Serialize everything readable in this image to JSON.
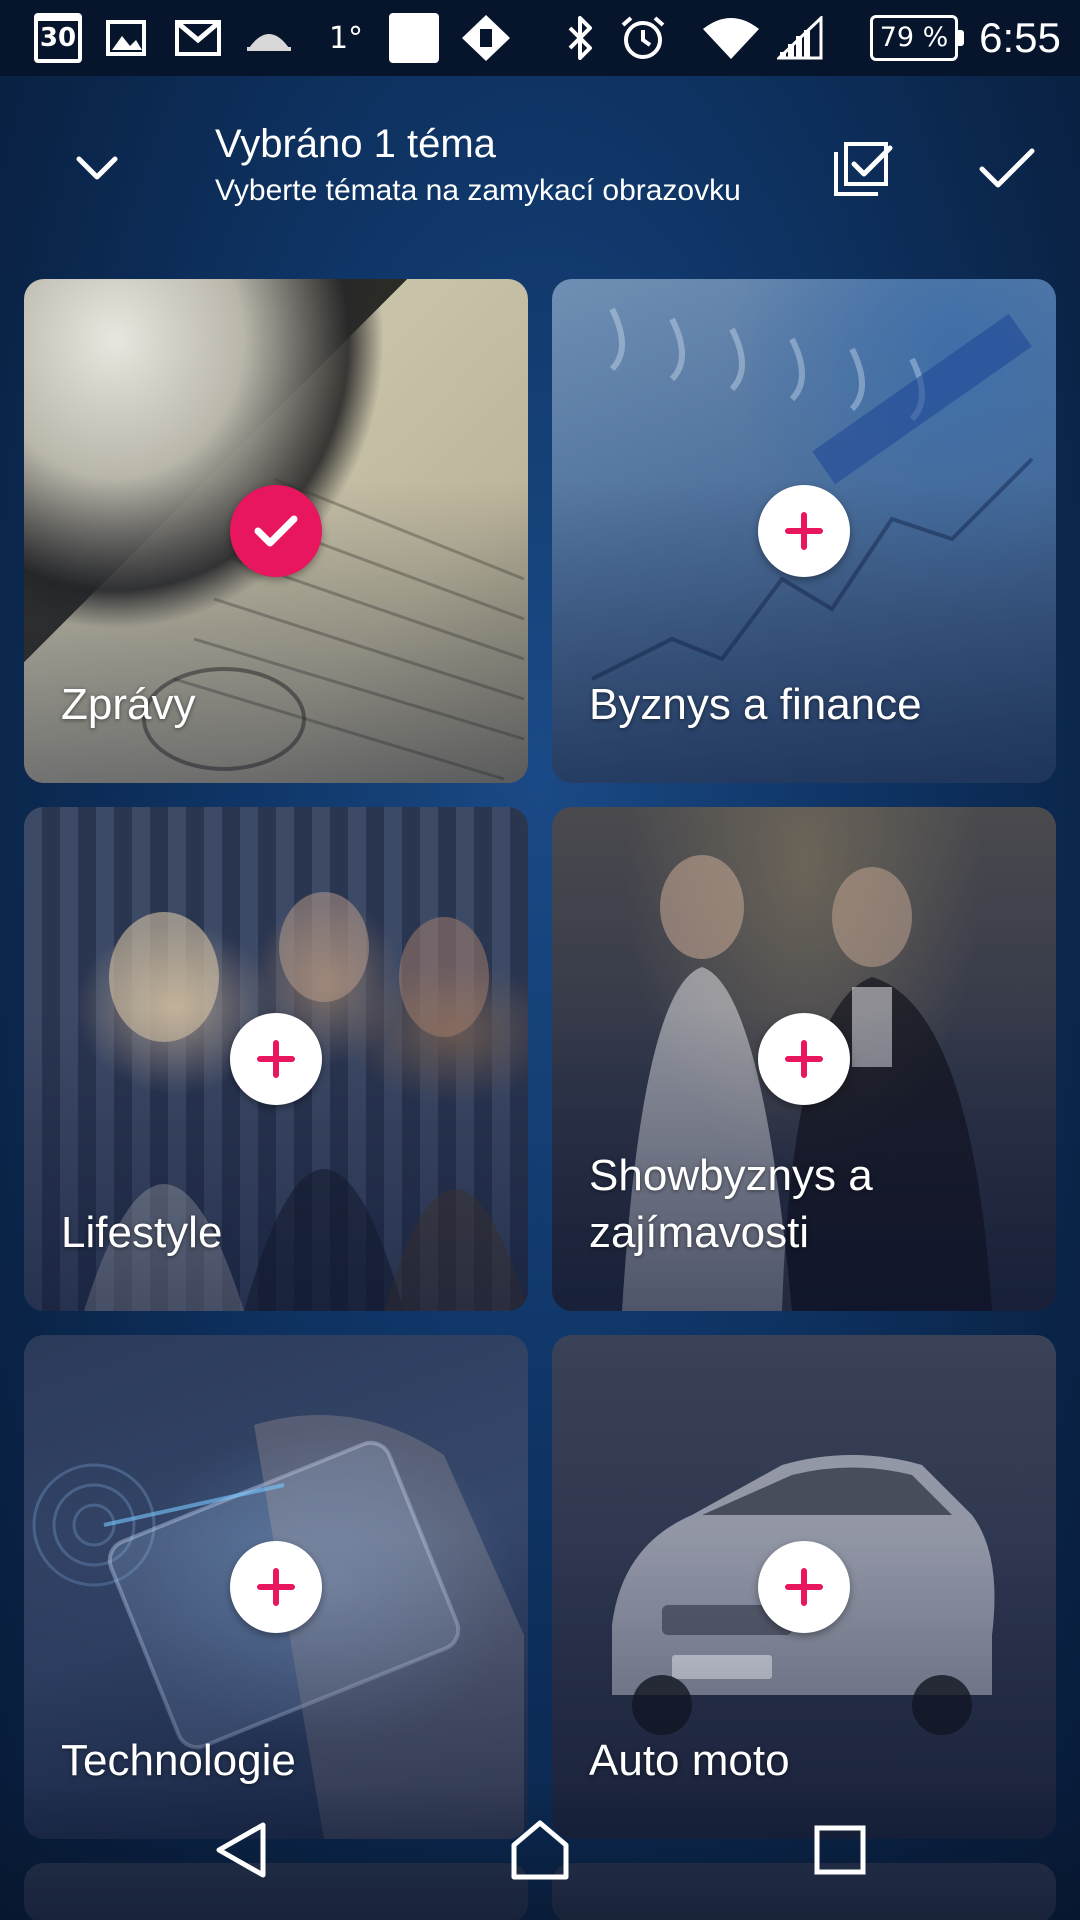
{
  "status_bar": {
    "calendar_day": "30",
    "temperature": "1°",
    "battery_percent": "79 %",
    "time": "6:55",
    "icons": [
      "calendar-icon",
      "gallery-icon",
      "gmail-icon",
      "weather-icon",
      "app-square-icon",
      "sync-app-icon",
      "bluetooth-icon",
      "alarm-icon",
      "wifi-icon",
      "signal-icon",
      "battery-icon"
    ]
  },
  "header": {
    "title": "Vybráno 1 téma",
    "subtitle": "Vyberte témata na zamykací obrazovku",
    "icons": [
      "chevron-down-icon",
      "select-all-icon",
      "confirm-check-icon"
    ]
  },
  "tiles": [
    {
      "label": "Zprávy",
      "state": "selected"
    },
    {
      "label": "Byznys a finance",
      "state": "add"
    },
    {
      "label": "Lifestyle",
      "state": "add"
    },
    {
      "label": "Showbyznys a zajímavosti",
      "state": "add"
    },
    {
      "label": "Technologie",
      "state": "add"
    },
    {
      "label": "Auto moto",
      "state": "add"
    }
  ],
  "colors": {
    "accent": "#e8155f",
    "background": "#0f3566",
    "status_bar": "#07152c"
  },
  "nav_bar": {
    "icons": [
      "back-icon",
      "home-icon",
      "recents-icon"
    ]
  }
}
